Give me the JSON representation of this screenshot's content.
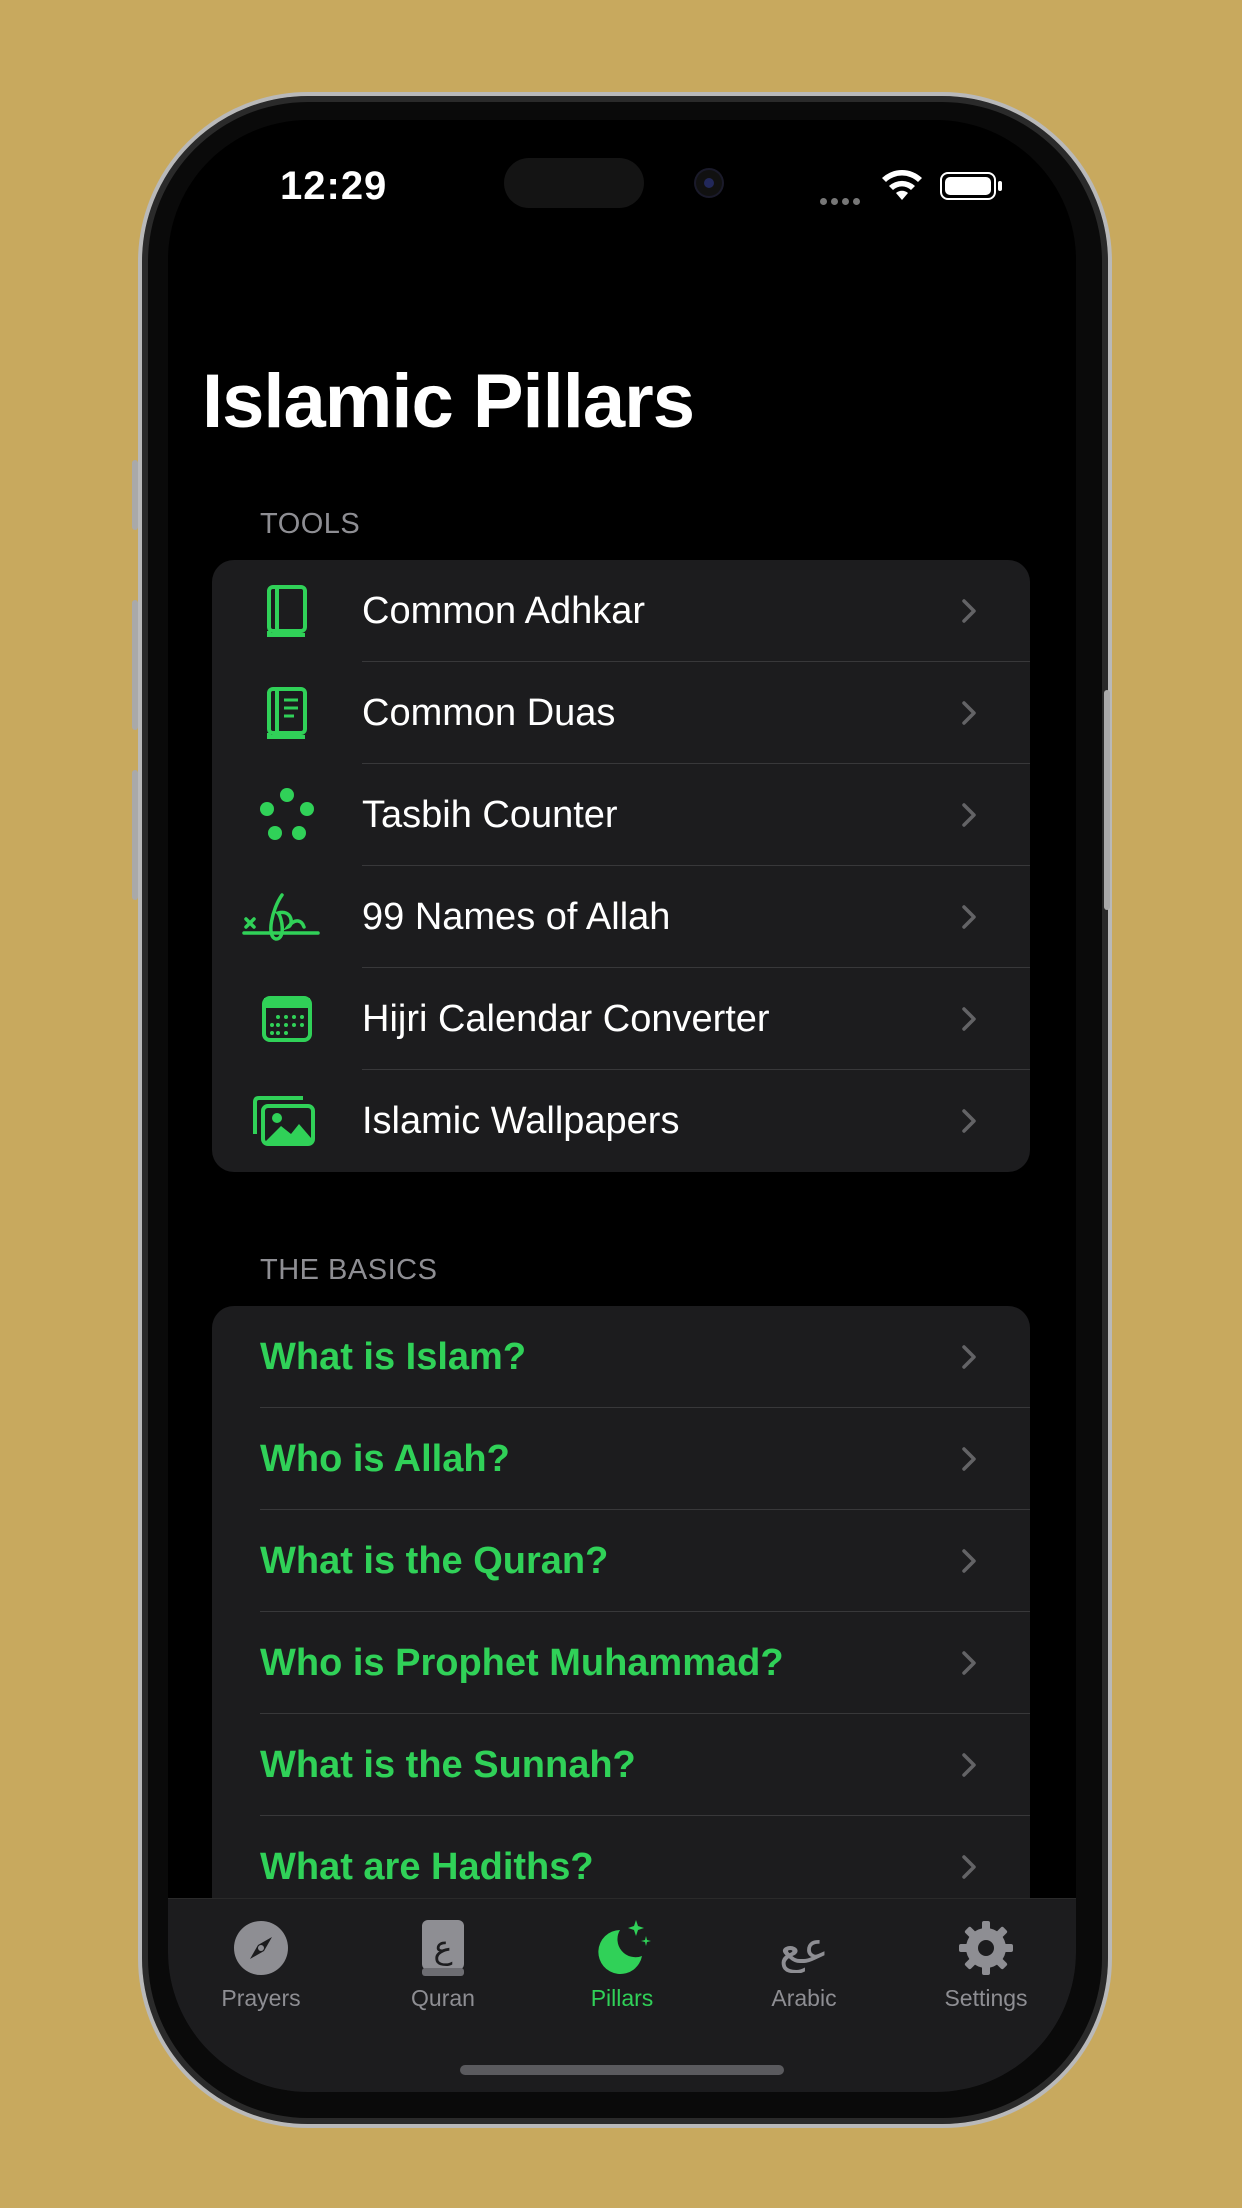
{
  "status": {
    "time": "12:29"
  },
  "page": {
    "title": "Islamic Pillars"
  },
  "tools": {
    "header": "TOOLS",
    "items": [
      {
        "label": "Common Adhkar",
        "icon": "book-icon"
      },
      {
        "label": "Common Duas",
        "icon": "book-pages-icon"
      },
      {
        "label": "Tasbih Counter",
        "icon": "beads-icon"
      },
      {
        "label": "99 Names of Allah",
        "icon": "signature-icon"
      },
      {
        "label": "Hijri Calendar Converter",
        "icon": "calendar-icon"
      },
      {
        "label": "Islamic Wallpapers",
        "icon": "photos-icon"
      }
    ]
  },
  "basics": {
    "header": "THE BASICS",
    "items": [
      {
        "label": "What is Islam?"
      },
      {
        "label": "Who is Allah?"
      },
      {
        "label": "What is the Quran?"
      },
      {
        "label": "Who is Prophet Muhammad?"
      },
      {
        "label": "What is the Sunnah?"
      },
      {
        "label": "What are Hadiths?"
      }
    ]
  },
  "tabbar": {
    "tabs": [
      {
        "label": "Prayers",
        "icon": "compass-icon"
      },
      {
        "label": "Quran",
        "icon": "quran-book-icon"
      },
      {
        "label": "Pillars",
        "icon": "moon-stars-icon",
        "active": true
      },
      {
        "label": "Arabic",
        "icon": "arabic-letters-icon"
      },
      {
        "label": "Settings",
        "icon": "gear-icon"
      }
    ]
  },
  "colors": {
    "accent": "#30d158",
    "background": "#000000",
    "cell": "#1c1c1e",
    "frame": "#c8a95e"
  }
}
